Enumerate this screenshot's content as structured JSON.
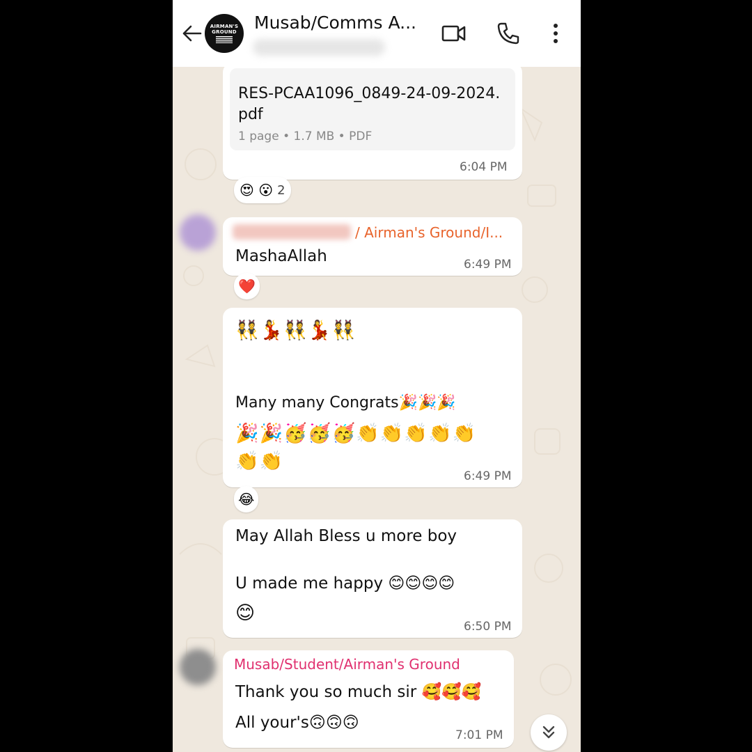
{
  "header": {
    "contact_name": "Musab/Comms A...",
    "logo_text": "AIRMAN'S GROUND"
  },
  "messages": {
    "doc": {
      "filename_line1": "RES-PCAA1096_0849-24-09-2024.",
      "filename_line2": "pdf",
      "meta": "1 page • 1.7 MB • PDF",
      "time": "6:04 PM",
      "reaction_emojis": "😍 😮",
      "reaction_count": "2"
    },
    "masha": {
      "sender": "/ Airman's Ground/I...",
      "text": "MashaAllah",
      "time": "6:49 PM",
      "reaction": "❤️"
    },
    "congrats": {
      "emoji_row1": "👯💃👯💃👯",
      "text": "Many many Congrats🎉🎉🎉",
      "emoji_row2": "🎉🎉🥳🥳🥳👏👏👏👏👏",
      "emoji_row3": "👏👏",
      "time": "6:49 PM",
      "reaction": "😂"
    },
    "bless": {
      "line1": "May Allah Bless u more boy",
      "line2": "U made me happy 😊😊😊😊",
      "line3": "😊",
      "time": "6:50 PM"
    },
    "thanks": {
      "sender": "Musab/Student/Airman's Ground",
      "line1": "Thank you so much sir 🥰🥰🥰",
      "line2": "All your's🙃🙃🙃",
      "time": "7:01 PM"
    }
  },
  "icons": {
    "back": "arrow-left-icon",
    "video": "video-call-icon",
    "call": "phone-icon",
    "menu": "more-vertical-icon",
    "scroll": "chevron-double-down-icon"
  },
  "colors": {
    "wallpaper": "#efe8de",
    "sender_orange": "#e8632b",
    "sender_pink": "#e0306f"
  }
}
